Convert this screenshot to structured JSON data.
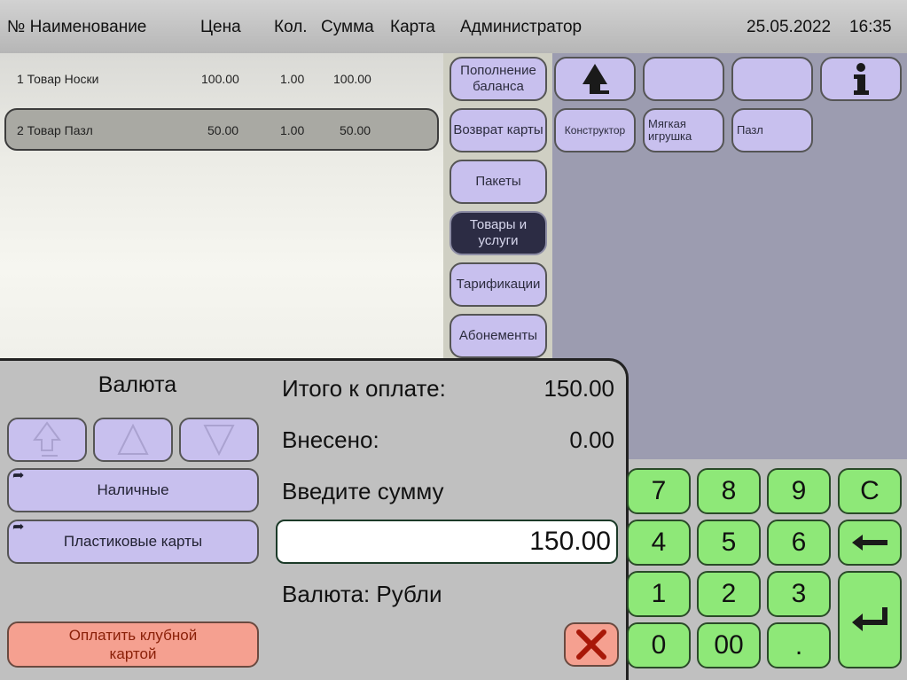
{
  "header": {
    "col_name": "№ Наименование",
    "col_price": "Цена",
    "col_qty": "Кол.",
    "col_sum": "Сумма",
    "col_card": "Карта",
    "user": "Администратор",
    "date": "25.05.2022",
    "time": "16:35"
  },
  "order_rows": [
    {
      "name": "1 Товар Носки",
      "price": "100.00",
      "qty": "1.00",
      "sum": "100.00",
      "selected": false
    },
    {
      "name": "2 Товар Пазл",
      "price": "50.00",
      "qty": "1.00",
      "sum": "50.00",
      "selected": true
    }
  ],
  "categories": [
    {
      "label": "Пополнение баланса"
    },
    {
      "label": "Возврат карты"
    },
    {
      "label": "Пакеты"
    },
    {
      "label": "Товары и услуги"
    },
    {
      "label": "Тарификации"
    },
    {
      "label": "Абонементы"
    }
  ],
  "products": [
    {
      "label": "Конструктор"
    },
    {
      "label": "Мягкая игрушка"
    },
    {
      "label": "Пазл"
    }
  ],
  "payment": {
    "currency_title": "Валюта",
    "method_cash": "Наличные",
    "method_cards": "Пластиковые карты",
    "club_card": "Оплатить клубной картой",
    "total_label": "Итого к оплате:",
    "total_value": "150.00",
    "paid_label": "Внесено:",
    "paid_value": "0.00",
    "enter_label": "Введите сумму",
    "amount_value": "150.00",
    "currency_label": "Валюта: Рубли"
  },
  "numpad": {
    "k7": "7",
    "k8": "8",
    "k9": "9",
    "kc": "C",
    "k4": "4",
    "k5": "5",
    "k6": "6",
    "k1": "1",
    "k2": "2",
    "k3": "3",
    "k0": "0",
    "k00": "00",
    "kdot": "."
  },
  "colors": {
    "button_lavender": "#c8c0ee",
    "active_category": "#2c2c44",
    "numpad_green": "#8ee878",
    "club_salmon": "#f5a090",
    "product_panel": "#9c9cb0"
  },
  "icons": [
    "up-arrow-icon",
    "info-icon",
    "scroll-top-icon",
    "scroll-up-icon",
    "scroll-down-icon",
    "backspace-icon",
    "enter-icon",
    "cancel-x-icon",
    "method-arrow-icon"
  ]
}
